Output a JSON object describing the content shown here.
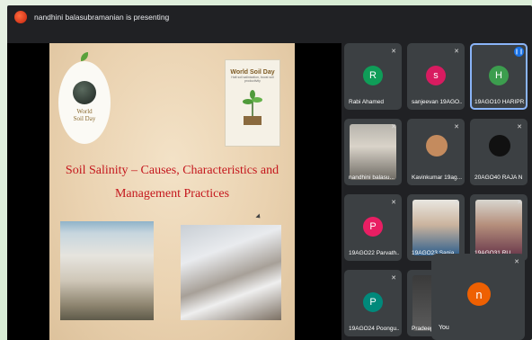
{
  "presenter": {
    "text": "nandhini balasubramanian is presenting"
  },
  "slide": {
    "logo_text_line1": "World",
    "logo_text_line2": "Soil Day",
    "poster_title": "World Soil Day",
    "poster_sub": "Halt soil salinization, boost soil productivity",
    "title_line1": "Soil Salinity – Causes, Characteristics and",
    "title_line2": "Management Practices"
  },
  "participants": [
    {
      "name": "Rabi Ahamed",
      "initial": "R",
      "color": "#0f9d58"
    },
    {
      "name": "sanjeevan 19AGO...",
      "initial": "s",
      "color": "#d81b60"
    },
    {
      "name": "19AGO10 HARIPR...",
      "initial": "H",
      "color": "#3c9d4e",
      "active": true
    },
    {
      "name": "nandhini balasu...",
      "video": true
    },
    {
      "name": "Kavinkumar 19ag...",
      "video": true
    },
    {
      "name": "20AGO40 RAJA N",
      "video": true
    },
    {
      "name": "19AGO22 Parvath...",
      "initial": "P",
      "color": "#e91e63"
    },
    {
      "name": "19AGO23 Sanja...",
      "video": true
    },
    {
      "name": "19AGO31 RU...",
      "video": true
    },
    {
      "name": "19AGO24 Poongu...",
      "initial": "P",
      "color": "#00897b"
    },
    {
      "name": "Pradeep...",
      "video": true
    }
  ],
  "self": {
    "initial": "n",
    "label": "You"
  },
  "icons": {
    "mic_off": "mic-off-icon",
    "speaking": "speaking-icon",
    "cursor": "cursor-icon"
  }
}
